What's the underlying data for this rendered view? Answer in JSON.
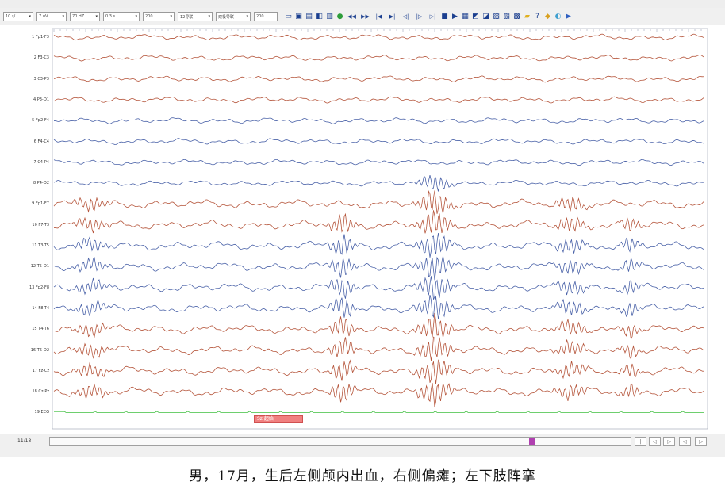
{
  "toolbar": {
    "combos": [
      {
        "name": "montage-select",
        "text": "10 s/"
      },
      {
        "name": "sensitivity-select",
        "text": "7 uV"
      },
      {
        "name": "lowcut-select",
        "text": "70 HZ"
      },
      {
        "name": "highcut-select",
        "text": "0.3 s"
      },
      {
        "name": "notch-select",
        "text": "200"
      },
      {
        "name": "speed-select",
        "text": "12导联"
      },
      {
        "name": "channels-select",
        "text": "双极导联"
      },
      {
        "name": "page-input",
        "text": "200"
      }
    ],
    "buttons": [
      {
        "name": "open-icon",
        "glyph": "▭"
      },
      {
        "name": "save-icon",
        "glyph": "▣"
      },
      {
        "name": "print-icon",
        "glyph": "▤"
      },
      {
        "name": "export-icon",
        "glyph": "◧"
      },
      {
        "name": "montage-icon",
        "glyph": "▥"
      },
      {
        "name": "refresh-icon",
        "glyph": "●",
        "color": "#2e9d3a"
      },
      {
        "name": "rewind-icon",
        "glyph": "◀◀"
      },
      {
        "name": "fast-forward-icon",
        "glyph": "▶▶"
      },
      {
        "name": "step-back-icon",
        "glyph": "|◀"
      },
      {
        "name": "step-forward-icon",
        "glyph": "▶|"
      },
      {
        "name": "page-back-icon",
        "glyph": "◁|"
      },
      {
        "name": "page-forward-icon",
        "glyph": "|▷"
      },
      {
        "name": "page-end-icon",
        "glyph": "▷|"
      },
      {
        "name": "stop-icon",
        "glyph": "■"
      },
      {
        "name": "play-icon",
        "glyph": "▶"
      },
      {
        "name": "report-icon",
        "glyph": "▦"
      },
      {
        "name": "video-icon",
        "glyph": "◩"
      },
      {
        "name": "marker-icon",
        "glyph": "◪"
      },
      {
        "name": "note-icon",
        "glyph": "▧"
      },
      {
        "name": "analysis-icon",
        "glyph": "▨"
      },
      {
        "name": "settings-icon",
        "glyph": "▩"
      },
      {
        "name": "folder-icon",
        "glyph": "▰",
        "color": "#e0b020"
      },
      {
        "name": "help-icon",
        "glyph": "?"
      },
      {
        "name": "shield-icon",
        "glyph": "◆",
        "color": "#d8a020"
      },
      {
        "name": "photic-icon",
        "glyph": "◐",
        "color": "#40a0d0"
      },
      {
        "name": "exit-icon",
        "glyph": "▶",
        "color": "#3060c0"
      }
    ]
  },
  "channels": [
    {
      "label": "1 Fp1-F3",
      "color": "#b5553b"
    },
    {
      "label": "2 F3-C3",
      "color": "#b5553b"
    },
    {
      "label": "3 C3-P3",
      "color": "#b5553b"
    },
    {
      "label": "4 P3-O1",
      "color": "#b5553b"
    },
    {
      "label": "5 Fp2-F4",
      "color": "#4a62a8"
    },
    {
      "label": "6 F4-C4",
      "color": "#4a62a8"
    },
    {
      "label": "7 C4-P4",
      "color": "#4a62a8"
    },
    {
      "label": "8 P4-O2",
      "color": "#4a62a8"
    },
    {
      "label": "9 Fp1-F7",
      "color": "#b5553b"
    },
    {
      "label": "10 F7-T3",
      "color": "#b5553b"
    },
    {
      "label": "11 T3-T5",
      "color": "#4a62a8"
    },
    {
      "label": "12 T5-O1",
      "color": "#4a62a8"
    },
    {
      "label": "13 Fp2-F8",
      "color": "#4a62a8"
    },
    {
      "label": "14 F8-T4",
      "color": "#4a62a8"
    },
    {
      "label": "15 T4-T6",
      "color": "#b5553b"
    },
    {
      "label": "16 T6-O2",
      "color": "#b5553b"
    },
    {
      "label": "17 Fz-Cz",
      "color": "#b5553b"
    },
    {
      "label": "18 Cz-Pz",
      "color": "#b5553b"
    },
    {
      "label": "19 ECG",
      "color": "#3fbf3f"
    }
  ],
  "event_marker": {
    "label": "Sz 起始"
  },
  "statusbar": {
    "time": "11:13",
    "buttons": [
      "|",
      "◁",
      "▷",
      "◁",
      "▷"
    ]
  },
  "caption": "男，17月，生后左侧颅内出血，右侧偏瘫；左下肢阵挛"
}
